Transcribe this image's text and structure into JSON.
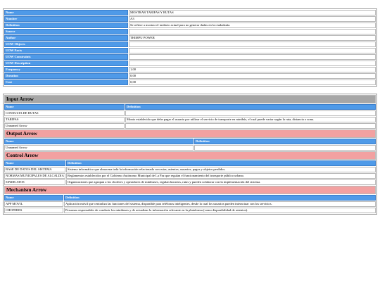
{
  "function_table": {
    "rows": [
      {
        "key": "Name",
        "value": "MOSTRAR TARIFAS  Y RUTAS"
      },
      {
        "key": "Number",
        "value": "A3"
      },
      {
        "key": "Definition",
        "value": "Se refiere a mostrar el tarifario actual para no generar dudas en la ciudadanía."
      },
      {
        "key": "Source",
        "value": ""
      },
      {
        "key": "Author",
        "value": "THIMPU POWER"
      },
      {
        "key": "UOW Objects",
        "value": ""
      },
      {
        "key": "UOW Facts",
        "value": ""
      },
      {
        "key": "UOW Constraints",
        "value": ""
      },
      {
        "key": "UOW Description",
        "value": ""
      },
      {
        "key": "Frequency",
        "value": "1,00"
      },
      {
        "key": "Duration",
        "value": "0,00"
      },
      {
        "key": "Cost",
        "value": "0,00"
      }
    ]
  },
  "input_arrow": {
    "title": "Input Arrow",
    "col_name": "Name",
    "col_definition": "Definition",
    "rows": [
      {
        "name": "CONSULTA DE RUTAS",
        "definition": ""
      },
      {
        "name": "TARIFAS",
        "definition": "Monto establecido que debe pagar el usuario por utilizar el servicio de transporte en minibús, el cual puede variar según la ruta, distancia o zona."
      },
      {
        "name": "Unnamed Arrow",
        "definition": ""
      }
    ]
  },
  "output_arrow": {
    "title": "Output Arrow",
    "col_name": "Name",
    "col_definition": "Definition",
    "rows": [
      {
        "name": "Unnamed Arrow",
        "definition": ""
      }
    ]
  },
  "control_arrow": {
    "title": "Control Arrow",
    "col_name": "Name",
    "col_definition": "Definition",
    "rows": [
      {
        "name": "BASE DE DATOS DEL SISTEMA",
        "definition": "Sistema informático que almacena toda la información relacionada con rutas, asientos, usuarios, pagos y objetos perdidos."
      },
      {
        "name": "NORMAS MUNICIPALES DE ALCALDIA",
        "definition": "Reglamentos establecidos por el Gobierno Autónomo Municipal de La Paz que regulan el funcionamiento del transporte público urbano."
      },
      {
        "name": "SINDICATOS",
        "definition": "Organizaciones que agrupan a los choferes y operadores de minibuses, regulan horarios, rutas y pueden colaborar con la implementación del sistema."
      }
    ]
  },
  "mechanism_arrow": {
    "title": "Mechanism Arrow",
    "col_name": "Name",
    "col_definition": "Definition",
    "rows": [
      {
        "name": "APP MOVIL",
        "definition": "Aplicación móvil que centraliza las funciones del sistema, disponible para teléfonos inteligentes, desde la cual los usuarios pueden interactuar con los servicios."
      },
      {
        "name": "CHOFERES",
        "definition": "Personas responsables de conducir los minibuses y de actualizar la información relevante en la plataforma (como disponibilidad de asientos)."
      }
    ]
  }
}
